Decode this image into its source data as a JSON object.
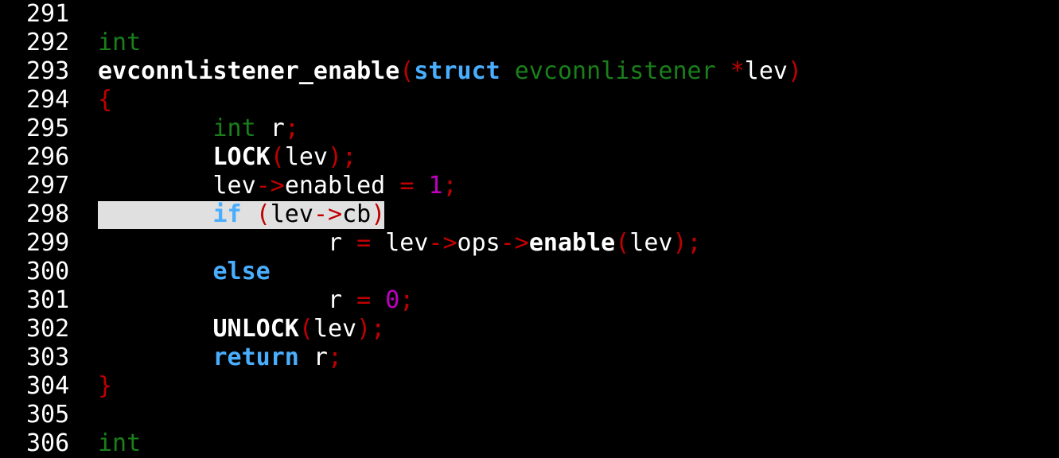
{
  "colors": {
    "background": "#000000",
    "line_number": "#ffffff",
    "identifier": "#ffffff",
    "type": "#1a7f1a",
    "keyword": "#4aaeff",
    "punctuation": "#c00000",
    "number": "#c000c0",
    "cursorline": "#e0e0e0"
  },
  "editor": {
    "cursor_line": "298",
    "lines": [
      {
        "num": "291",
        "tokens": []
      },
      {
        "num": "292",
        "tokens": [
          {
            "t": "int",
            "c": "type"
          }
        ]
      },
      {
        "num": "293",
        "tokens": [
          {
            "t": "evconnlistener_enable",
            "c": "bold"
          },
          {
            "t": "(",
            "c": "punc"
          },
          {
            "t": "struct",
            "c": "kw"
          },
          {
            "t": " ",
            "c": "plain"
          },
          {
            "t": "evconnlistener",
            "c": "type"
          },
          {
            "t": " ",
            "c": "plain"
          },
          {
            "t": "*",
            "c": "punc"
          },
          {
            "t": "lev",
            "c": "plain"
          },
          {
            "t": ")",
            "c": "punc"
          }
        ]
      },
      {
        "num": "294",
        "tokens": [
          {
            "t": "{",
            "c": "punc"
          }
        ]
      },
      {
        "num": "295",
        "tokens": [
          {
            "t": "        ",
            "c": "plain"
          },
          {
            "t": "int",
            "c": "type"
          },
          {
            "t": " r",
            "c": "plain"
          },
          {
            "t": ";",
            "c": "punc"
          }
        ]
      },
      {
        "num": "296",
        "tokens": [
          {
            "t": "        ",
            "c": "plain"
          },
          {
            "t": "LOCK",
            "c": "bold"
          },
          {
            "t": "(",
            "c": "punc"
          },
          {
            "t": "lev",
            "c": "plain"
          },
          {
            "t": ");",
            "c": "punc"
          }
        ]
      },
      {
        "num": "297",
        "tokens": [
          {
            "t": "        lev",
            "c": "plain"
          },
          {
            "t": "->",
            "c": "punc"
          },
          {
            "t": "enabled ",
            "c": "plain"
          },
          {
            "t": "=",
            "c": "punc"
          },
          {
            "t": " ",
            "c": "plain"
          },
          {
            "t": "1",
            "c": "num"
          },
          {
            "t": ";",
            "c": "punc"
          }
        ]
      },
      {
        "num": "298",
        "tokens": [
          {
            "t": "        ",
            "c": "plain"
          },
          {
            "t": "if",
            "c": "kw"
          },
          {
            "t": " ",
            "c": "plain"
          },
          {
            "t": "(",
            "c": "punc"
          },
          {
            "t": "lev",
            "c": "plain"
          },
          {
            "t": "->",
            "c": "punc"
          },
          {
            "t": "cb",
            "c": "plain"
          },
          {
            "t": ")",
            "c": "punc"
          }
        ]
      },
      {
        "num": "299",
        "tokens": [
          {
            "t": "                r ",
            "c": "plain"
          },
          {
            "t": "=",
            "c": "punc"
          },
          {
            "t": " lev",
            "c": "plain"
          },
          {
            "t": "->",
            "c": "punc"
          },
          {
            "t": "ops",
            "c": "plain"
          },
          {
            "t": "->",
            "c": "punc"
          },
          {
            "t": "enable",
            "c": "bold"
          },
          {
            "t": "(",
            "c": "punc"
          },
          {
            "t": "lev",
            "c": "plain"
          },
          {
            "t": ");",
            "c": "punc"
          }
        ]
      },
      {
        "num": "300",
        "tokens": [
          {
            "t": "        ",
            "c": "plain"
          },
          {
            "t": "else",
            "c": "kw"
          }
        ]
      },
      {
        "num": "301",
        "tokens": [
          {
            "t": "                r ",
            "c": "plain"
          },
          {
            "t": "=",
            "c": "punc"
          },
          {
            "t": " ",
            "c": "plain"
          },
          {
            "t": "0",
            "c": "num"
          },
          {
            "t": ";",
            "c": "punc"
          }
        ]
      },
      {
        "num": "302",
        "tokens": [
          {
            "t": "        ",
            "c": "plain"
          },
          {
            "t": "UNLOCK",
            "c": "bold"
          },
          {
            "t": "(",
            "c": "punc"
          },
          {
            "t": "lev",
            "c": "plain"
          },
          {
            "t": ");",
            "c": "punc"
          }
        ]
      },
      {
        "num": "303",
        "tokens": [
          {
            "t": "        ",
            "c": "plain"
          },
          {
            "t": "return",
            "c": "kw"
          },
          {
            "t": " r",
            "c": "plain"
          },
          {
            "t": ";",
            "c": "punc"
          }
        ]
      },
      {
        "num": "304",
        "tokens": [
          {
            "t": "}",
            "c": "punc"
          }
        ]
      },
      {
        "num": "305",
        "tokens": []
      },
      {
        "num": "306",
        "tokens": [
          {
            "t": "int",
            "c": "type"
          }
        ]
      }
    ]
  }
}
